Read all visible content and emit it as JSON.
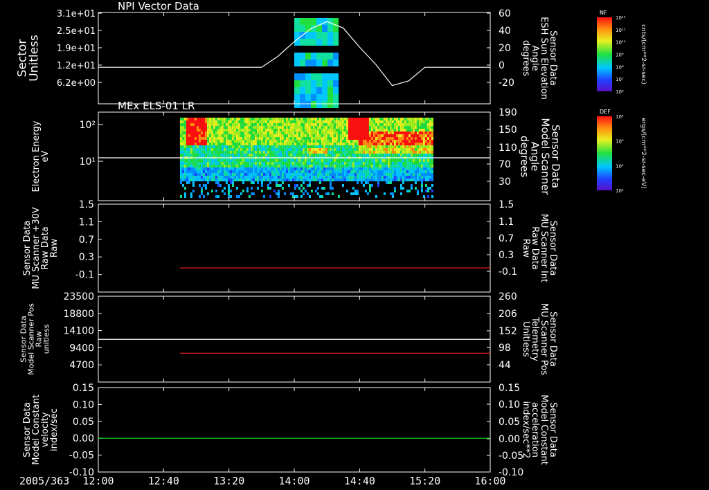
{
  "chart_data": [
    {
      "type": "heatmap",
      "title": "NPI Vector Data",
      "ylabel": "Sector\nUnitless",
      "y_ticks": [
        "3.1e+01",
        "2.5e+01",
        "1.9e+01",
        "1.2e+01",
        "6.2e+00"
      ],
      "y_right_ticks": [
        "60",
        "40",
        "20",
        "0",
        "-20"
      ],
      "y_right_label": "Sensor Data\nESH Sun Elevation\nAngle\ndegrees",
      "ylim_right": [
        -40,
        60
      ],
      "colorbar": {
        "name": "NF",
        "unit": "cnts/(cm**2-sr-sec)",
        "ticks": [
          "10¹²",
          "10¹¹",
          "10¹⁰",
          "10⁹",
          "10⁸",
          "10⁷",
          "10⁶"
        ]
      },
      "overlay_line": {
        "name": "ESH Sun Elevation Angle",
        "color": "#ffffff",
        "x": [
          "12:00",
          "13:40",
          "13:50",
          "14:00",
          "14:10",
          "14:20",
          "14:30",
          "14:40",
          "14:50",
          "15:00",
          "15:10",
          "15:20",
          "16:00"
        ],
        "y": [
          0,
          0,
          12,
          28,
          42,
          50,
          43,
          22,
          3,
          -20,
          -15,
          0,
          0
        ]
      },
      "data_window": [
        "14:00",
        "14:25"
      ]
    },
    {
      "type": "heatmap",
      "title": "MEx ELS-01 LR",
      "ylabel": "Electron Energy\neV",
      "y_ticks": [
        "10²",
        "10¹"
      ],
      "y_right_ticks": [
        "190",
        "150",
        "110",
        "70",
        "30"
      ],
      "y_right_label": "Sensor Data\nModel Scanner\nAngle\ndegrees",
      "ylim_right": [
        0,
        190
      ],
      "colorbar": {
        "name": "DEF",
        "unit": "ergs/(cm**2-sr-sec-eV)",
        "ticks": [
          "10⁴",
          "10³",
          "10²",
          "10¹"
        ]
      },
      "overlay_line": {
        "name": "Model Scanner Angle",
        "color": "#ffffff",
        "x": [
          "12:00",
          "16:00"
        ],
        "y": [
          92,
          92
        ]
      },
      "data_window": [
        "12:50",
        "15:25"
      ]
    },
    {
      "type": "line",
      "ylabel": "Sensor Data\nMU Scanner +30V\nRaw Data\nRaw",
      "y_ticks": [
        "1.5",
        "1.1",
        "0.7",
        "0.3",
        "-0.1"
      ],
      "ylim": [
        -0.5,
        1.5
      ],
      "y_right_ticks": [
        "1.5",
        "1.1",
        "0.7",
        "0.3",
        "-0.1"
      ],
      "y_right_label": "Sensor Data\nMU Scanner Int\nRaw Data\nRaw",
      "series": [
        {
          "name": "MU Scanner Int",
          "color": "#ff2020",
          "x": [
            "12:50",
            "16:00"
          ],
          "y": [
            0.05,
            0.05
          ]
        }
      ]
    },
    {
      "type": "line",
      "ylabel": "Sensor Data\nModel Scanner Pos\nRaw\nunitless",
      "y_ticks": [
        "23500",
        "18800",
        "14100",
        "9400",
        "4700"
      ],
      "ylim": [
        0,
        23500
      ],
      "y_right_ticks": [
        "260",
        "206",
        "152",
        "98",
        "44"
      ],
      "y_right_label": "Sensor Data\nMU Scanner Pos\nTelemetry\nUnitless",
      "series": [
        {
          "name": "Model Scanner Pos",
          "color": "#ffffff",
          "x": [
            "12:00",
            "16:00"
          ],
          "y": [
            11700,
            11700
          ]
        },
        {
          "name": "MU Scanner Pos",
          "color": "#ff2020",
          "x": [
            "12:50",
            "16:00"
          ],
          "y": [
            7900,
            7900
          ]
        }
      ]
    },
    {
      "type": "line",
      "ylabel": "Sensor Data\nModel Constant\nvelocity\nindex/sec",
      "y_ticks": [
        "0.15",
        "0.10",
        "0.05",
        "0.00",
        "-0.05",
        "-0.10"
      ],
      "ylim": [
        -0.1,
        0.15
      ],
      "y_right_ticks": [
        "0.15",
        "0.10",
        "0.05",
        "0.00",
        "-0.05",
        "-0.10"
      ],
      "y_right_label": "Sensor Data\nModel Constant\nacceleration\nindex/sec**2",
      "series": [
        {
          "name": "Model Constant acceleration",
          "color": "#20e020",
          "x": [
            "12:00",
            "16:00"
          ],
          "y": [
            0.0,
            0.0
          ]
        }
      ]
    }
  ],
  "x_axis": {
    "date": "2005/363",
    "ticks": [
      "12:00",
      "12:40",
      "13:20",
      "14:00",
      "14:40",
      "15:20",
      "16:00"
    ],
    "xlim": [
      "12:00",
      "16:00"
    ]
  },
  "colors": {
    "background": "#000000",
    "axis": "#ffffff",
    "red_series": "#ff2020",
    "green_series": "#20e020"
  }
}
